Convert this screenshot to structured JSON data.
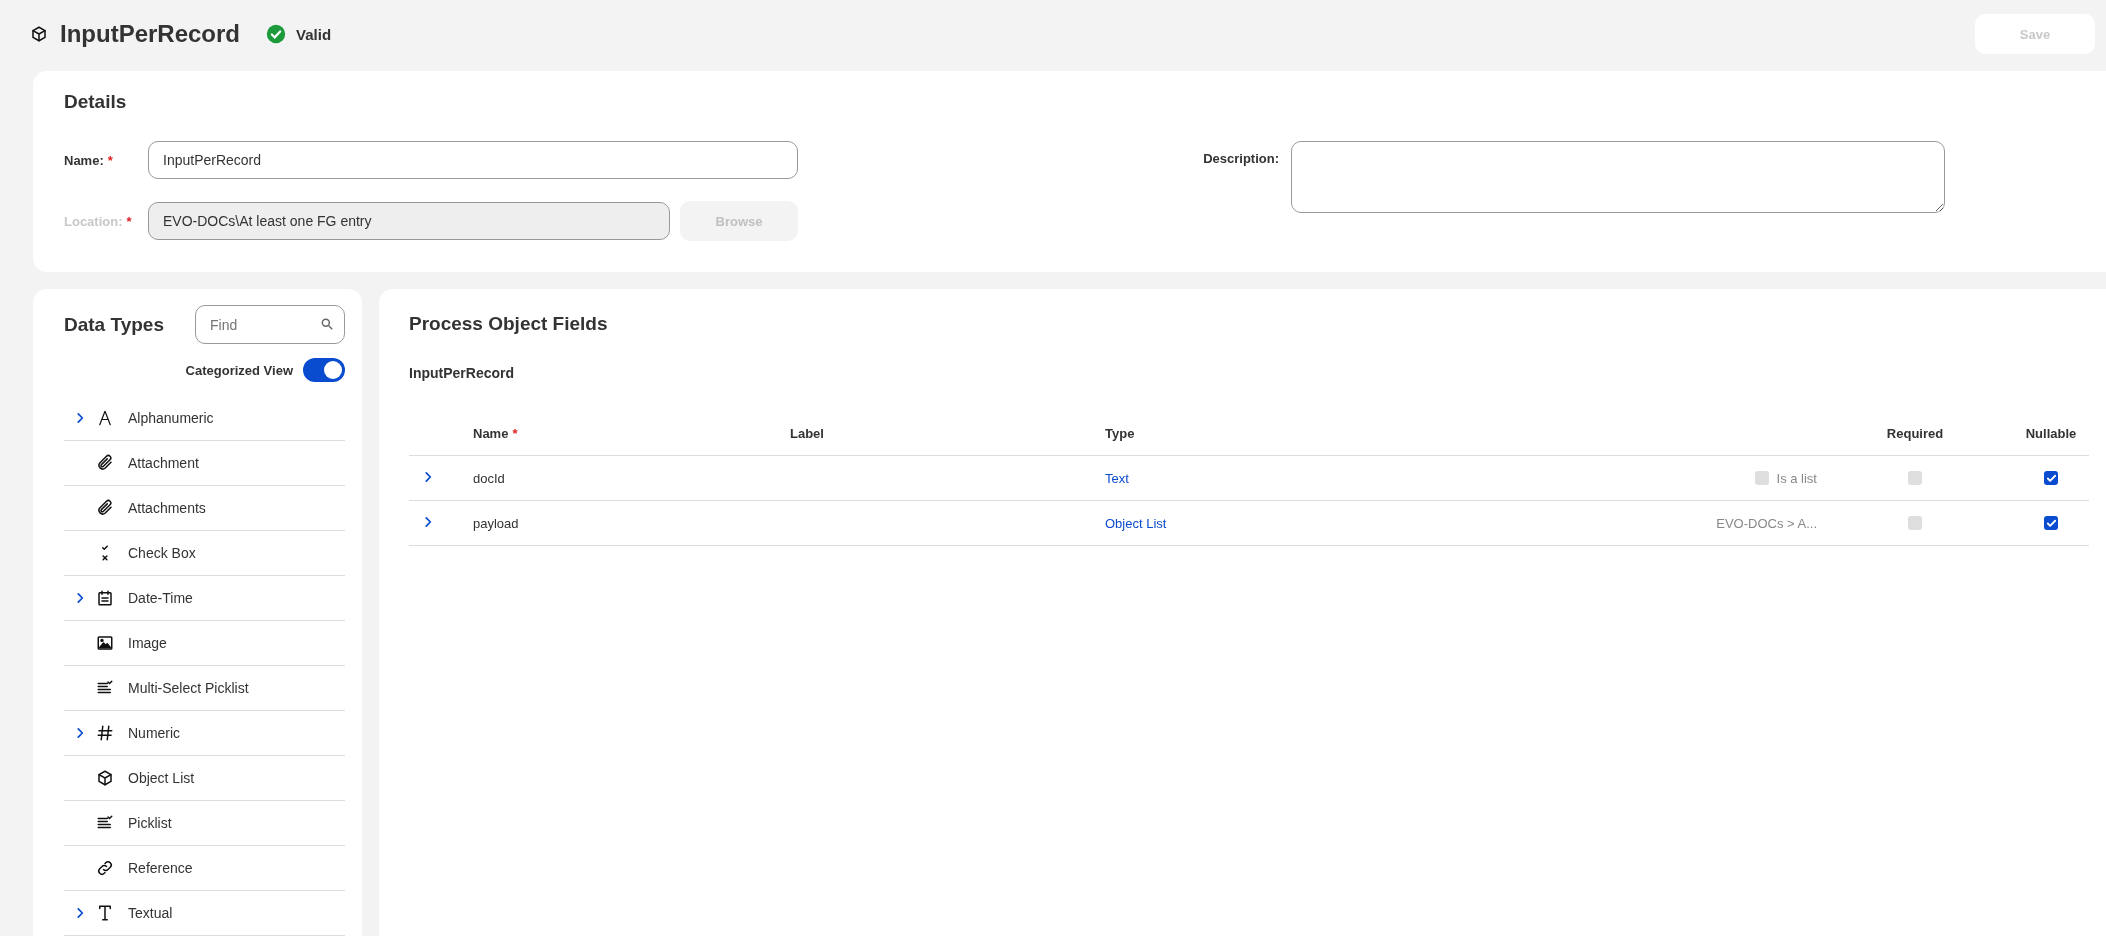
{
  "header": {
    "title": "InputPerRecord",
    "status": "Valid",
    "save_button": {
      "label": "Save",
      "disabled": true
    }
  },
  "details": {
    "title": "Details",
    "name_field": {
      "label": "Name:",
      "required_mark": "*",
      "value": "InputPerRecord"
    },
    "location_field": {
      "label": "Location:",
      "required_mark": "*",
      "value": "EVO-DOCs\\At least one FG entry",
      "disabled": true
    },
    "browse_button": {
      "label": "Browse",
      "disabled": true
    },
    "description_field": {
      "label": "Description:"
    }
  },
  "data_types": {
    "title": "Data Types",
    "search": {
      "placeholder": "Find"
    },
    "categorized_view": {
      "label": "Categorized View",
      "on": true
    },
    "items": [
      {
        "label": "Alphanumeric",
        "kind": "letter",
        "expandable": true
      },
      {
        "label": "Attachment",
        "kind": "clip",
        "expandable": false
      },
      {
        "label": "Attachments",
        "kind": "clip",
        "expandable": false
      },
      {
        "label": "Check Box",
        "kind": "checkx",
        "expandable": false
      },
      {
        "label": "Date-Time",
        "kind": "calendar",
        "expandable": true
      },
      {
        "label": "Image",
        "kind": "image",
        "expandable": false
      },
      {
        "label": "Multi-Select Picklist",
        "kind": "checklist",
        "expandable": false
      },
      {
        "label": "Numeric",
        "kind": "hash",
        "expandable": true
      },
      {
        "label": "Object List",
        "kind": "cube",
        "expandable": false
      },
      {
        "label": "Picklist",
        "kind": "checklist",
        "expandable": false
      },
      {
        "label": "Reference",
        "kind": "link",
        "expandable": false
      },
      {
        "label": "Textual",
        "kind": "serif",
        "expandable": true
      }
    ]
  },
  "fields": {
    "title": "Process Object Fields",
    "object_name": "InputPerRecord",
    "columns": [
      {
        "label": "Name",
        "required_mark": "*"
      },
      {
        "label": "Label"
      },
      {
        "label": "Type"
      },
      {
        "label": "Required"
      },
      {
        "label": "Nullable"
      }
    ],
    "rows": [
      {
        "name": "docId",
        "type": "Text",
        "extra": {
          "kind": "checkbox",
          "label": "Is a list",
          "checked": false
        },
        "required": false,
        "nullable": true
      },
      {
        "name": "payload",
        "type": "Object List",
        "extra": {
          "kind": "text",
          "label": "EVO-DOCs > A..."
        },
        "required": false,
        "nullable": true
      }
    ]
  }
}
